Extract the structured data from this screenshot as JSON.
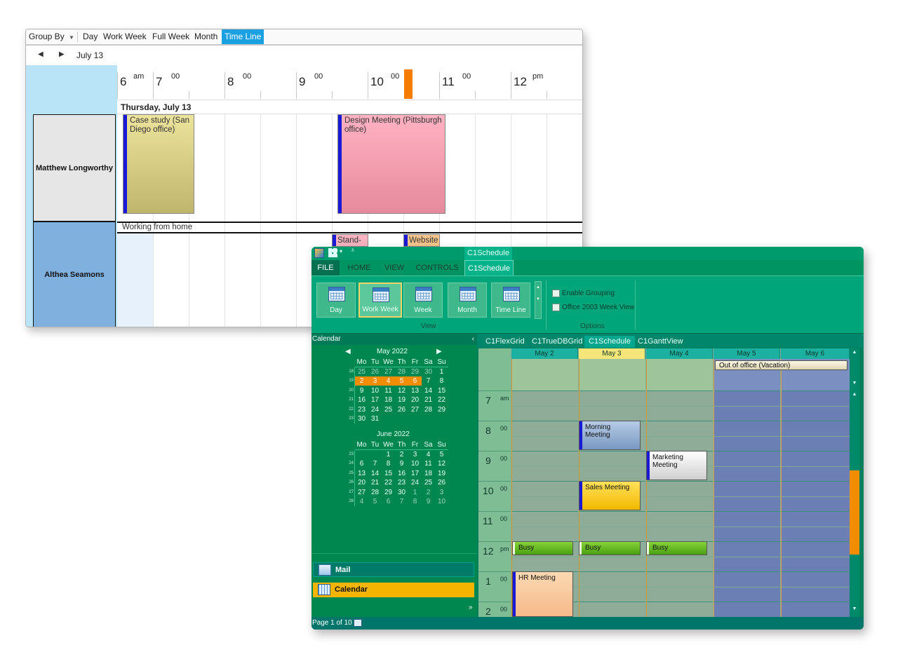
{
  "timeline": {
    "toolbar": {
      "group_by": "Group By",
      "views": [
        "Day",
        "Work Week",
        "Full Week",
        "Month",
        "Time Line"
      ],
      "active_view": "Time Line"
    },
    "nav": {
      "date_label": "July 13"
    },
    "hours": [
      {
        "label": "6",
        "sup": "am"
      },
      {
        "label": "7",
        "sup": "00"
      },
      {
        "label": "8",
        "sup": "00"
      },
      {
        "label": "9",
        "sup": "00"
      },
      {
        "label": "10",
        "sup": "00"
      },
      {
        "label": "11",
        "sup": "00"
      },
      {
        "label": "12",
        "sup": "pm"
      }
    ],
    "date_header": "Thursday, July 13",
    "resources": [
      "Matthew Longworthy",
      "Althea Seamons"
    ],
    "appointments": {
      "case_study": "Case study (San Diego office)",
      "design_meeting": "Design Meeting (Pittsburgh office)",
      "working_from_home": "Working from home",
      "standup": "Stand-",
      "website": "Website"
    },
    "colors": {
      "active_tab": "#1ba1e2",
      "now_marker": "#f57c00",
      "resource_header": "#b9e4f8",
      "selected_resource": "#7fb0de"
    }
  },
  "schedule": {
    "title_tab": "C1Schedule",
    "ribbon_tabs": [
      "FILE",
      "HOME",
      "VIEW",
      "CONTROLS",
      "C1Schedule"
    ],
    "ribbon_buttons": [
      "Day",
      "Work Week",
      "Week",
      "Month",
      "Time Line"
    ],
    "selected_button": "Work Week",
    "view_group": "View",
    "options_group": "Options",
    "options": [
      "Enable Grouping",
      "Office 2003 Week View"
    ],
    "left_pane_title": "Calendar",
    "may": {
      "title": "May  2022",
      "weekdays": [
        "Mo",
        "Tu",
        "We",
        "Th",
        "Fr",
        "Sa",
        "Su"
      ],
      "weeks": [
        "18",
        "19",
        "20",
        "21",
        "22",
        "23"
      ],
      "days": [
        [
          "25",
          "26",
          "27",
          "28",
          "29",
          "30",
          "1"
        ],
        [
          "2",
          "3",
          "4",
          "5",
          "6",
          "7",
          "8"
        ],
        [
          "9",
          "10",
          "11",
          "12",
          "13",
          "14",
          "15"
        ],
        [
          "16",
          "17",
          "18",
          "19",
          "20",
          "21",
          "22"
        ],
        [
          "23",
          "24",
          "25",
          "26",
          "27",
          "28",
          "29"
        ],
        [
          "30",
          "31",
          "",
          "",
          "",
          "",
          ""
        ]
      ]
    },
    "june": {
      "title": "June  2022",
      "weekdays": [
        "Mo",
        "Tu",
        "We",
        "Th",
        "Fr",
        "Sa",
        "Su"
      ],
      "weeks": [
        "23",
        "24",
        "25",
        "26",
        "27",
        "28"
      ],
      "days": [
        [
          "",
          "",
          "1",
          "2",
          "3",
          "4",
          "5"
        ],
        [
          "6",
          "7",
          "8",
          "9",
          "10",
          "11",
          "12"
        ],
        [
          "13",
          "14",
          "15",
          "16",
          "17",
          "18",
          "19"
        ],
        [
          "20",
          "21",
          "22",
          "23",
          "24",
          "25",
          "26"
        ],
        [
          "27",
          "28",
          "29",
          "30",
          "1",
          "2",
          "3"
        ],
        [
          "4",
          "5",
          "6",
          "7",
          "8",
          "9",
          "10"
        ]
      ]
    },
    "nav_buttons": [
      "Mail",
      "Calendar"
    ],
    "status": "Page 1 of 10",
    "sub_tabs": [
      "C1FlexGrid",
      "C1TrueDBGrid",
      "C1Schedule",
      "C1GanttView"
    ],
    "days": [
      "May 2",
      "May 3",
      "May 4",
      "May 5",
      "May 6"
    ],
    "today": "May 3",
    "times": [
      {
        "label": "7",
        "sup": "am"
      },
      {
        "label": "8",
        "sup": "00"
      },
      {
        "label": "9",
        "sup": "00"
      },
      {
        "label": "10",
        "sup": "00"
      },
      {
        "label": "11",
        "sup": "00"
      },
      {
        "label": "12",
        "sup": "pm"
      },
      {
        "label": "1",
        "sup": "00"
      },
      {
        "label": "2",
        "sup": "00"
      }
    ],
    "appointments": {
      "vacation": "Out of office (Vacation)",
      "morning": "Morning Meeting",
      "marketing": "Marketing Meeting",
      "sales": "Sales Meeting",
      "busy": "Busy",
      "hr": "HR Meeting"
    },
    "colors": {
      "window": "#007f5a",
      "ribbon": "#00a67a",
      "accent_orange": "#f28c00",
      "weekend": "#6b7fb5",
      "busy": "#5cb81c",
      "calendar_btn": "#f4b400"
    }
  }
}
